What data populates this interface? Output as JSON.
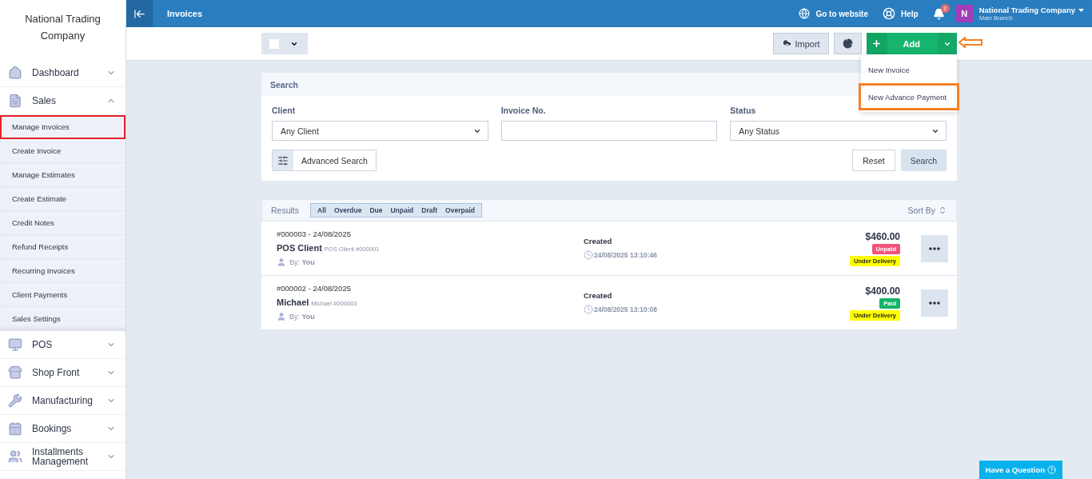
{
  "sidebar": {
    "company": "National Trading Company",
    "items": [
      {
        "label": "Dashboard",
        "expanded": false
      },
      {
        "label": "Sales",
        "expanded": true,
        "children": [
          {
            "label": "Manage Invoices",
            "highlighted": true
          },
          {
            "label": "Create Invoice",
            "highlighted": false
          },
          {
            "label": "Manage Estimates",
            "highlighted": false
          },
          {
            "label": "Create Estimate",
            "highlighted": false
          },
          {
            "label": "Credit Notes",
            "highlighted": false
          },
          {
            "label": "Refund Receipts",
            "highlighted": false
          },
          {
            "label": "Recurring Invoices",
            "highlighted": false
          },
          {
            "label": "Client Payments",
            "highlighted": false
          },
          {
            "label": "Sales Settings",
            "highlighted": false
          }
        ]
      },
      {
        "label": "POS",
        "expanded": false
      },
      {
        "label": "Shop Front",
        "expanded": false
      },
      {
        "label": "Manufacturing",
        "expanded": false
      },
      {
        "label": "Bookings",
        "expanded": false
      },
      {
        "label": "Installments Management",
        "expanded": false
      }
    ]
  },
  "topbar": {
    "title": "Invoices",
    "website": "Go to website",
    "help": "Help",
    "notifications": "2",
    "user": {
      "initial": "N",
      "name": "National Trading Company",
      "branch": "Main Branch"
    }
  },
  "toolbar": {
    "import": "Import",
    "add": "Add",
    "menu_open": true,
    "menu": [
      {
        "label": "New Invoice",
        "highlighted": false
      },
      {
        "label": "New Advance Payment",
        "highlighted": true
      }
    ]
  },
  "search": {
    "title": "Search",
    "fields": [
      {
        "label": "Client",
        "kind": "select",
        "value": "Any Client"
      },
      {
        "label": "Invoice No.",
        "kind": "text"
      },
      {
        "label": "Status",
        "kind": "select",
        "value": "Any Status"
      }
    ],
    "advanced": "Advanced Search",
    "reset": "Reset",
    "submit": "Search"
  },
  "results": {
    "title": "Results",
    "filters": [
      "All",
      "Overdue",
      "Due",
      "Unpaid",
      "Draft",
      "Overpaid"
    ],
    "sort": "Sort By",
    "rows": [
      {
        "number": "#000003 - 24/08/2025",
        "client": "POS Client",
        "client_ref": "POS Client #000001",
        "by_label": "By:",
        "by": "You",
        "status": "Created",
        "time": "24/08/2025 13:10:46",
        "amount": "$460.00",
        "payment": {
          "label": "Unpaid",
          "color": "#f2557a"
        },
        "delivery": "Under Delivery"
      },
      {
        "number": "#000002 - 24/08/2025",
        "client": "Michael",
        "client_ref": "Michael #000003",
        "by_label": "By:",
        "by": "You",
        "status": "Created",
        "time": "24/08/2025 13:10:08",
        "amount": "$400.00",
        "payment": {
          "label": "Paid",
          "color": "#13b46a"
        },
        "delivery": "Under Delivery"
      }
    ]
  },
  "help_button": "Have a Question"
}
